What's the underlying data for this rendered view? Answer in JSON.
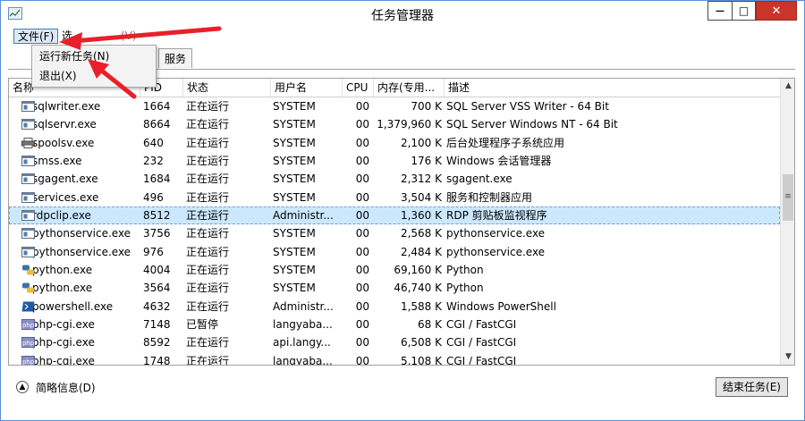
{
  "window": {
    "title": "任务管理器"
  },
  "titlebar_buttons": {
    "min": "—",
    "max": "□",
    "close": "✕"
  },
  "menu": {
    "file": "文件(F)",
    "options": "选",
    "view": "(V)"
  },
  "tabs": [
    {
      "label": "服务"
    }
  ],
  "file_menu": {
    "items": [
      {
        "label": "运行新任务(N)"
      },
      {
        "label": "退出(X)"
      }
    ]
  },
  "columns": {
    "name": "名称",
    "pid": "PID",
    "status": "状态",
    "user": "用户名",
    "cpu": "CPU",
    "memory": "内存(专用...",
    "description": "描述"
  },
  "processes": [
    {
      "name": "sqlwriter.exe",
      "pid": "1664",
      "status": "正在运行",
      "user": "SYSTEM",
      "cpu": "00",
      "memory": "700 K",
      "description": "SQL Server VSS Writer - 64 Bit",
      "icon": "app-window-icon"
    },
    {
      "name": "sqlservr.exe",
      "pid": "8664",
      "status": "正在运行",
      "user": "SYSTEM",
      "cpu": "00",
      "memory": "1,379,960 K",
      "description": "SQL Server Windows NT - 64 Bit",
      "icon": "app-window-icon"
    },
    {
      "name": "spoolsv.exe",
      "pid": "640",
      "status": "正在运行",
      "user": "SYSTEM",
      "cpu": "00",
      "memory": "2,100 K",
      "description": "后台处理程序子系统应用",
      "icon": "printer-icon"
    },
    {
      "name": "smss.exe",
      "pid": "232",
      "status": "正在运行",
      "user": "SYSTEM",
      "cpu": "00",
      "memory": "176 K",
      "description": "Windows 会话管理器",
      "icon": "app-window-icon"
    },
    {
      "name": "sgagent.exe",
      "pid": "1684",
      "status": "正在运行",
      "user": "SYSTEM",
      "cpu": "00",
      "memory": "2,312 K",
      "description": "sgagent.exe",
      "icon": "app-window-icon"
    },
    {
      "name": "services.exe",
      "pid": "496",
      "status": "正在运行",
      "user": "SYSTEM",
      "cpu": "00",
      "memory": "3,504 K",
      "description": "服务和控制器应用",
      "icon": "app-window-icon"
    },
    {
      "name": "rdpclip.exe",
      "pid": "8512",
      "status": "正在运行",
      "user": "Administr...",
      "cpu": "00",
      "memory": "1,360 K",
      "description": "RDP 剪贴板监视程序",
      "icon": "app-window-icon"
    },
    {
      "name": "pythonservice.exe",
      "pid": "3756",
      "status": "正在运行",
      "user": "SYSTEM",
      "cpu": "00",
      "memory": "2,568 K",
      "description": "pythonservice.exe",
      "icon": "app-window-icon"
    },
    {
      "name": "pythonservice.exe",
      "pid": "976",
      "status": "正在运行",
      "user": "SYSTEM",
      "cpu": "00",
      "memory": "2,484 K",
      "description": "pythonservice.exe",
      "icon": "app-window-icon"
    },
    {
      "name": "python.exe",
      "pid": "4004",
      "status": "正在运行",
      "user": "SYSTEM",
      "cpu": "00",
      "memory": "69,160 K",
      "description": "Python",
      "icon": "python-icon"
    },
    {
      "name": "python.exe",
      "pid": "3564",
      "status": "正在运行",
      "user": "SYSTEM",
      "cpu": "00",
      "memory": "46,740 K",
      "description": "Python",
      "icon": "python-icon"
    },
    {
      "name": "powershell.exe",
      "pid": "4632",
      "status": "正在运行",
      "user": "Administr...",
      "cpu": "00",
      "memory": "1,588 K",
      "description": "Windows PowerShell",
      "icon": "powershell-icon"
    },
    {
      "name": "php-cgi.exe",
      "pid": "7148",
      "status": "已暂停",
      "user": "langyaba...",
      "cpu": "00",
      "memory": "68 K",
      "description": "CGI / FastCGI",
      "icon": "php-icon"
    },
    {
      "name": "php-cgi.exe",
      "pid": "8592",
      "status": "正在运行",
      "user": "api.langy...",
      "cpu": "00",
      "memory": "6,508 K",
      "description": "CGI / FastCGI",
      "icon": "php-icon"
    },
    {
      "name": "php-cgi.exe",
      "pid": "1748",
      "status": "正在运行",
      "user": "langyaba...",
      "cpu": "00",
      "memory": "5,108 K",
      "description": "CGI / FastCGI",
      "icon": "php-icon"
    }
  ],
  "selected_process": "rdpclip.exe",
  "footer": {
    "fewer_details": "简略信息(D)",
    "end_task": "结束任务(E)"
  },
  "icon_labels": {
    "php": "php"
  },
  "colors": {
    "selected_row": "#cce8ff",
    "close_button": "#c7352b",
    "annotation_arrow": "#e8202a"
  }
}
